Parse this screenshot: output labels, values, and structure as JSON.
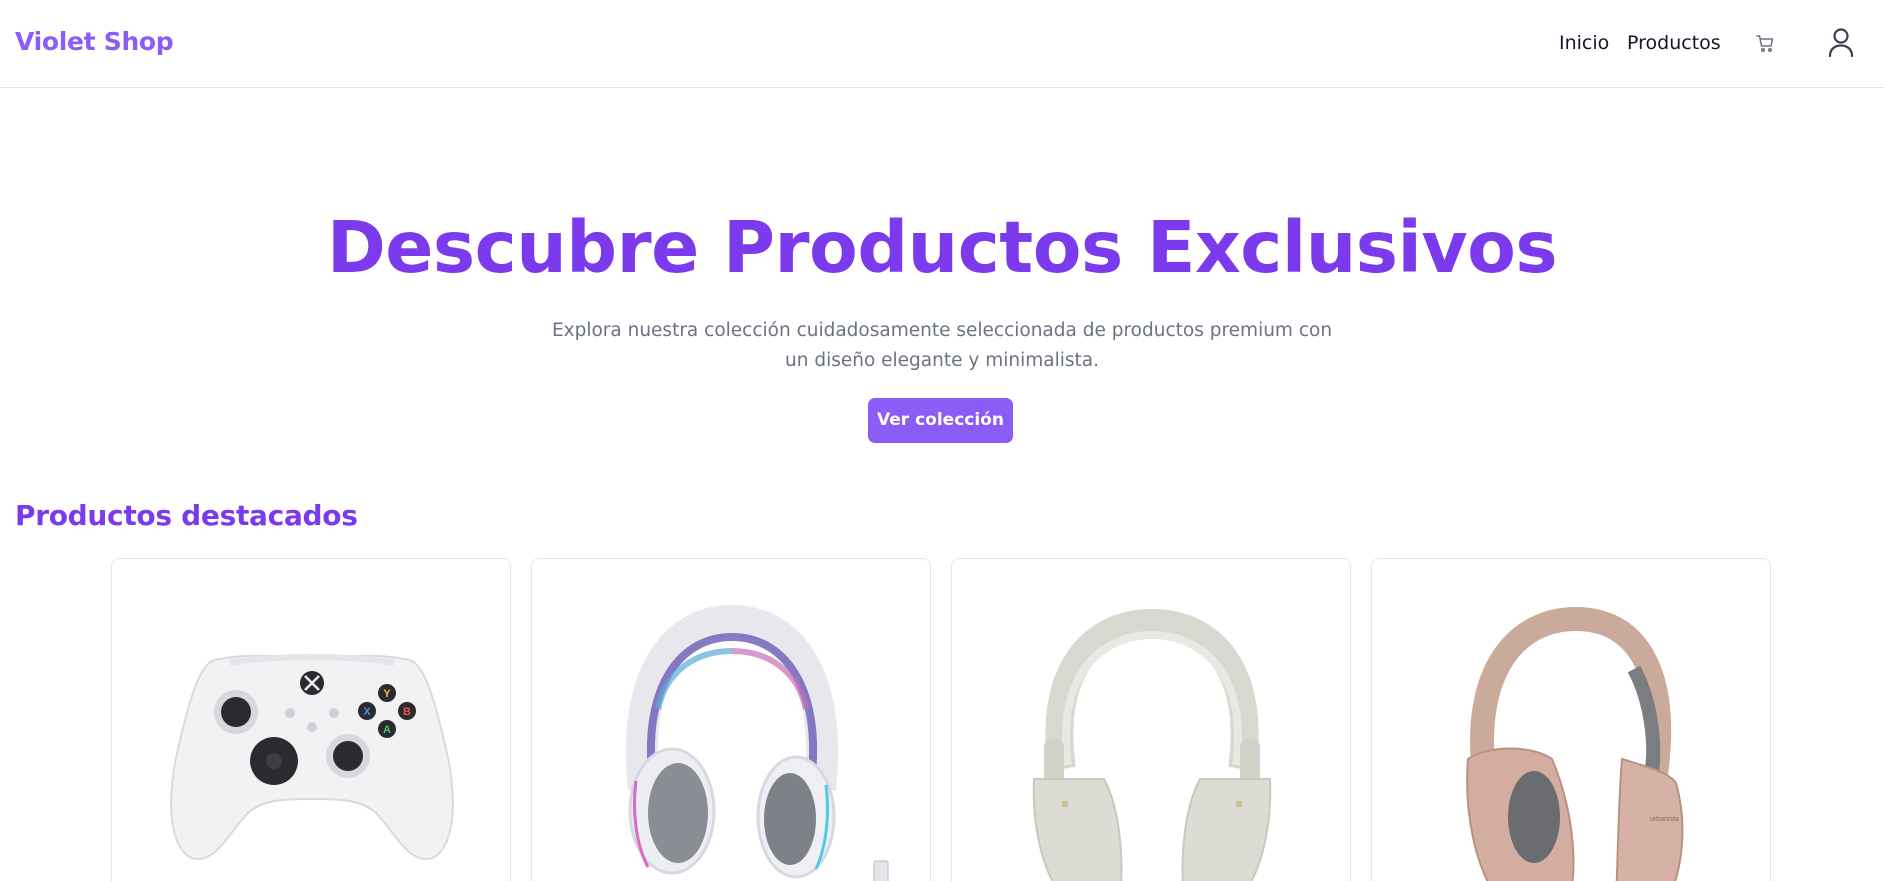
{
  "navbar": {
    "brand": "Violet Shop",
    "links": [
      "Inicio",
      "Productos"
    ],
    "cart_icon": "cart-icon",
    "user_icon": "user-icon"
  },
  "hero": {
    "title": "Descubre Productos Exclusivos",
    "subtitle": "Explora nuestra colección cuidadosamente seleccionada de productos premium con un diseño elegante y minimalista.",
    "cta_label": "Ver colección"
  },
  "featured": {
    "title": "Productos destacados",
    "products": [
      {
        "image": "white-game-controller"
      },
      {
        "image": "white-gaming-headset"
      },
      {
        "image": "beige-over-ear-headphones"
      },
      {
        "image": "rose-gold-over-ear-headphones"
      }
    ]
  },
  "colors": {
    "accent": "#8b5cf6",
    "accent_dark": "#7c3aed",
    "muted_text": "#6b7280",
    "border": "#e5e7eb"
  }
}
